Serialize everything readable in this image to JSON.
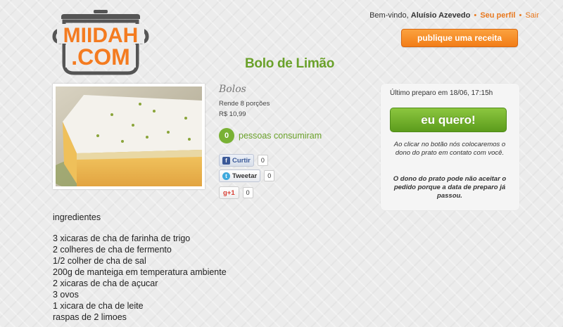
{
  "logo": {
    "line1": "MIIDAH",
    "line2": ".COM",
    "color": "#f47b20",
    "pot_color": "#555555"
  },
  "user_bar": {
    "greeting": "Bem-vindo,",
    "username": "Aluísio Azevedo",
    "separator": "•",
    "profile_link": "Seu perfil",
    "logout_link": "Sair"
  },
  "publish_button": "publique uma receita",
  "dish": {
    "title": "Bolo de Limão",
    "category": "Bolos",
    "serves": "Rende 8 porções",
    "price": "R$ 10,99",
    "consumed_count": "0",
    "consumed_label": "pessoas consumiram"
  },
  "social": {
    "facebook": {
      "label": "Curtir",
      "count": "0",
      "icon": "f"
    },
    "twitter": {
      "label": "Tweetar",
      "count": "0",
      "icon": "t"
    },
    "gplus": {
      "label": "g+1",
      "count": "0"
    }
  },
  "order": {
    "last_prep": "Último preparo em 18/06, 17:15h",
    "button": "eu quero!",
    "note": "Ao clicar no botão nós colocaremos o dono do prato em contato com você.",
    "warning": "O dono do prato pode não aceitar o pedido porque a data de preparo já passou."
  },
  "ingredients": {
    "title": "ingredientes",
    "items": [
      "3 xicaras de cha de farinha de trigo",
      "2 colheres de cha de fermento",
      "1/2 colher de cha de sal",
      "200g de manteiga em temperatura ambiente",
      "2 xicaras de cha de açucar",
      "3 ovos",
      "1 xicara de cha de leite",
      "raspas de 2 limoes"
    ]
  },
  "colors": {
    "orange": "#f27d17",
    "green": "#6aa12a",
    "fb_blue": "#3b5998",
    "tw_blue": "#3ea9dd",
    "gp_red": "#d73d32"
  }
}
